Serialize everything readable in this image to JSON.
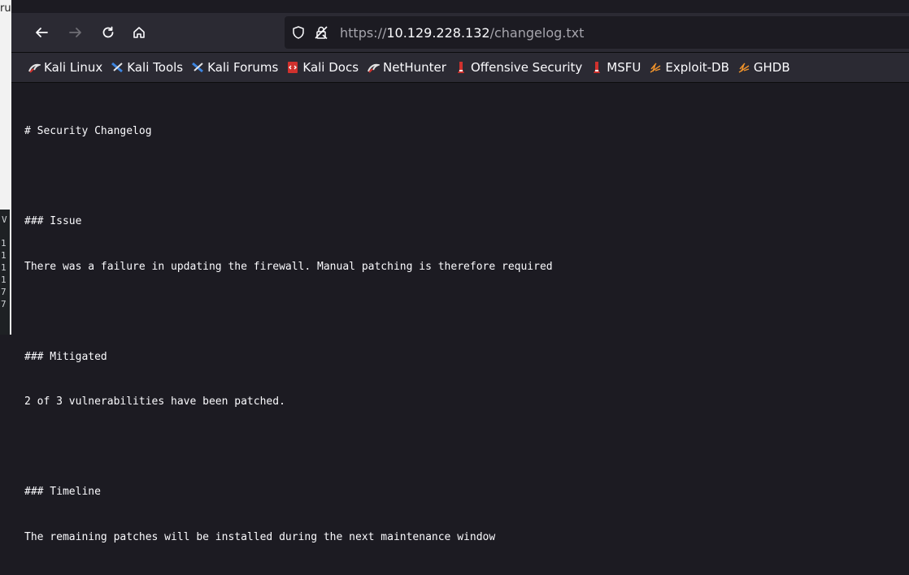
{
  "background_window": {
    "title_fragment": "ru",
    "terminal_letter": "V",
    "terminal_lines": [
      "1",
      "1",
      "1",
      "1",
      "7",
      "7"
    ]
  },
  "toolbar": {
    "back_label": "Back",
    "forward_label": "Forward",
    "reload_label": "Reload",
    "home_label": "Home"
  },
  "urlbar": {
    "scheme": "https://",
    "host": "10.129.228.132",
    "path": "/changelog.txt"
  },
  "bookmarks": [
    {
      "label": "Kali Linux",
      "icon": "kali-dragon-icon"
    },
    {
      "label": "Kali Tools",
      "icon": "kali-tools-icon"
    },
    {
      "label": "Kali Forums",
      "icon": "kali-forums-icon"
    },
    {
      "label": "Kali Docs",
      "icon": "kali-docs-icon"
    },
    {
      "label": "NetHunter",
      "icon": "nethunter-icon"
    },
    {
      "label": "Offensive Security",
      "icon": "offsec-icon"
    },
    {
      "label": "MSFU",
      "icon": "offsec-icon"
    },
    {
      "label": "Exploit-DB",
      "icon": "exploit-db-icon"
    },
    {
      "label": "GHDB",
      "icon": "exploit-db-icon"
    }
  ],
  "document": {
    "lines": [
      "# Security Changelog",
      "",
      "### Issue",
      "There was a failure in updating the firewall. Manual patching is therefore required",
      "",
      "### Mitigated",
      "2 of 3 vulnerabilities have been patched.",
      "",
      "### Timeline",
      "The remaining patches will be installed during the next maintenance window"
    ]
  },
  "colors": {
    "page_bg": "#1c1b22",
    "toolbar_bg": "#2b2a33",
    "text": "#fbfbfe",
    "muted_text": "#a6a5ad"
  }
}
